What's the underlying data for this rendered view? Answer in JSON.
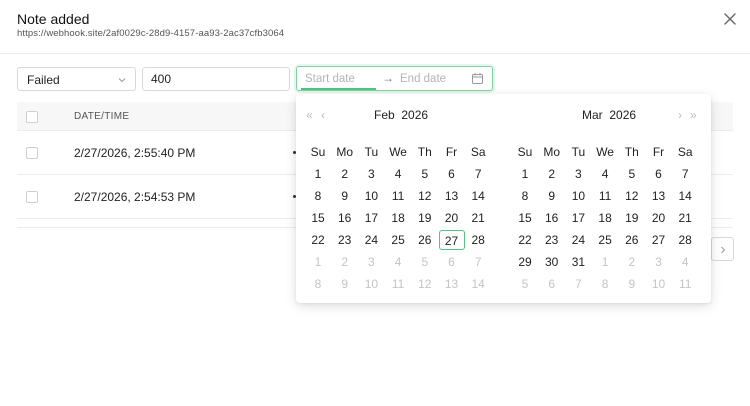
{
  "header": {
    "title": "Note added",
    "url": "https://webhook.site/2af0029c-28d9-4157-aa93-2ac37cfb3064"
  },
  "filters": {
    "status_value": "Failed",
    "code_value": "400",
    "start_placeholder": "Start date",
    "end_placeholder": "End date",
    "range_arrow": "→"
  },
  "table": {
    "column_datetime": "DATE/TIME",
    "rows": [
      {
        "datetime": "2/27/2026, 2:55:40 PM"
      },
      {
        "datetime": "2/27/2026, 2:54:53 PM"
      }
    ]
  },
  "calendar": {
    "nav": {
      "super_prev": "«",
      "prev": "‹",
      "next": "›",
      "super_next": "»"
    },
    "weekdays": [
      "Su",
      "Mo",
      "Tu",
      "We",
      "Th",
      "Fr",
      "Sa"
    ],
    "left": {
      "month": "Feb",
      "year": "2026",
      "days": [
        [
          "1",
          "2",
          "3",
          "4",
          "5",
          "6",
          "7"
        ],
        [
          "8",
          "9",
          "10",
          "11",
          "12",
          "13",
          "14"
        ],
        [
          "15",
          "16",
          "17",
          "18",
          "19",
          "20",
          "21"
        ],
        [
          "22",
          "23",
          "24",
          "25",
          "26",
          "27",
          "28"
        ],
        [
          "1",
          "2",
          "3",
          "4",
          "5",
          "6",
          "7"
        ],
        [
          "8",
          "9",
          "10",
          "11",
          "12",
          "13",
          "14"
        ]
      ],
      "current_month_cells": 28,
      "today_index": 26
    },
    "right": {
      "month": "Mar",
      "year": "2026",
      "days": [
        [
          "1",
          "2",
          "3",
          "4",
          "5",
          "6",
          "7"
        ],
        [
          "8",
          "9",
          "10",
          "11",
          "12",
          "13",
          "14"
        ],
        [
          "15",
          "16",
          "17",
          "18",
          "19",
          "20",
          "21"
        ],
        [
          "22",
          "23",
          "24",
          "25",
          "26",
          "27",
          "28"
        ],
        [
          "29",
          "30",
          "31",
          "1",
          "2",
          "3",
          "4"
        ],
        [
          "5",
          "6",
          "7",
          "8",
          "9",
          "10",
          "11"
        ]
      ],
      "current_month_cells": 31
    }
  },
  "colors": {
    "accent": "#52c47e",
    "muted_day": "#c4c4c4",
    "border": "#d9d9d9"
  },
  "icons": {
    "close": "close-icon",
    "select_chevron": "chevron-down-icon",
    "calendar": "calendar-icon",
    "pager_next": "chevron-right-icon"
  }
}
